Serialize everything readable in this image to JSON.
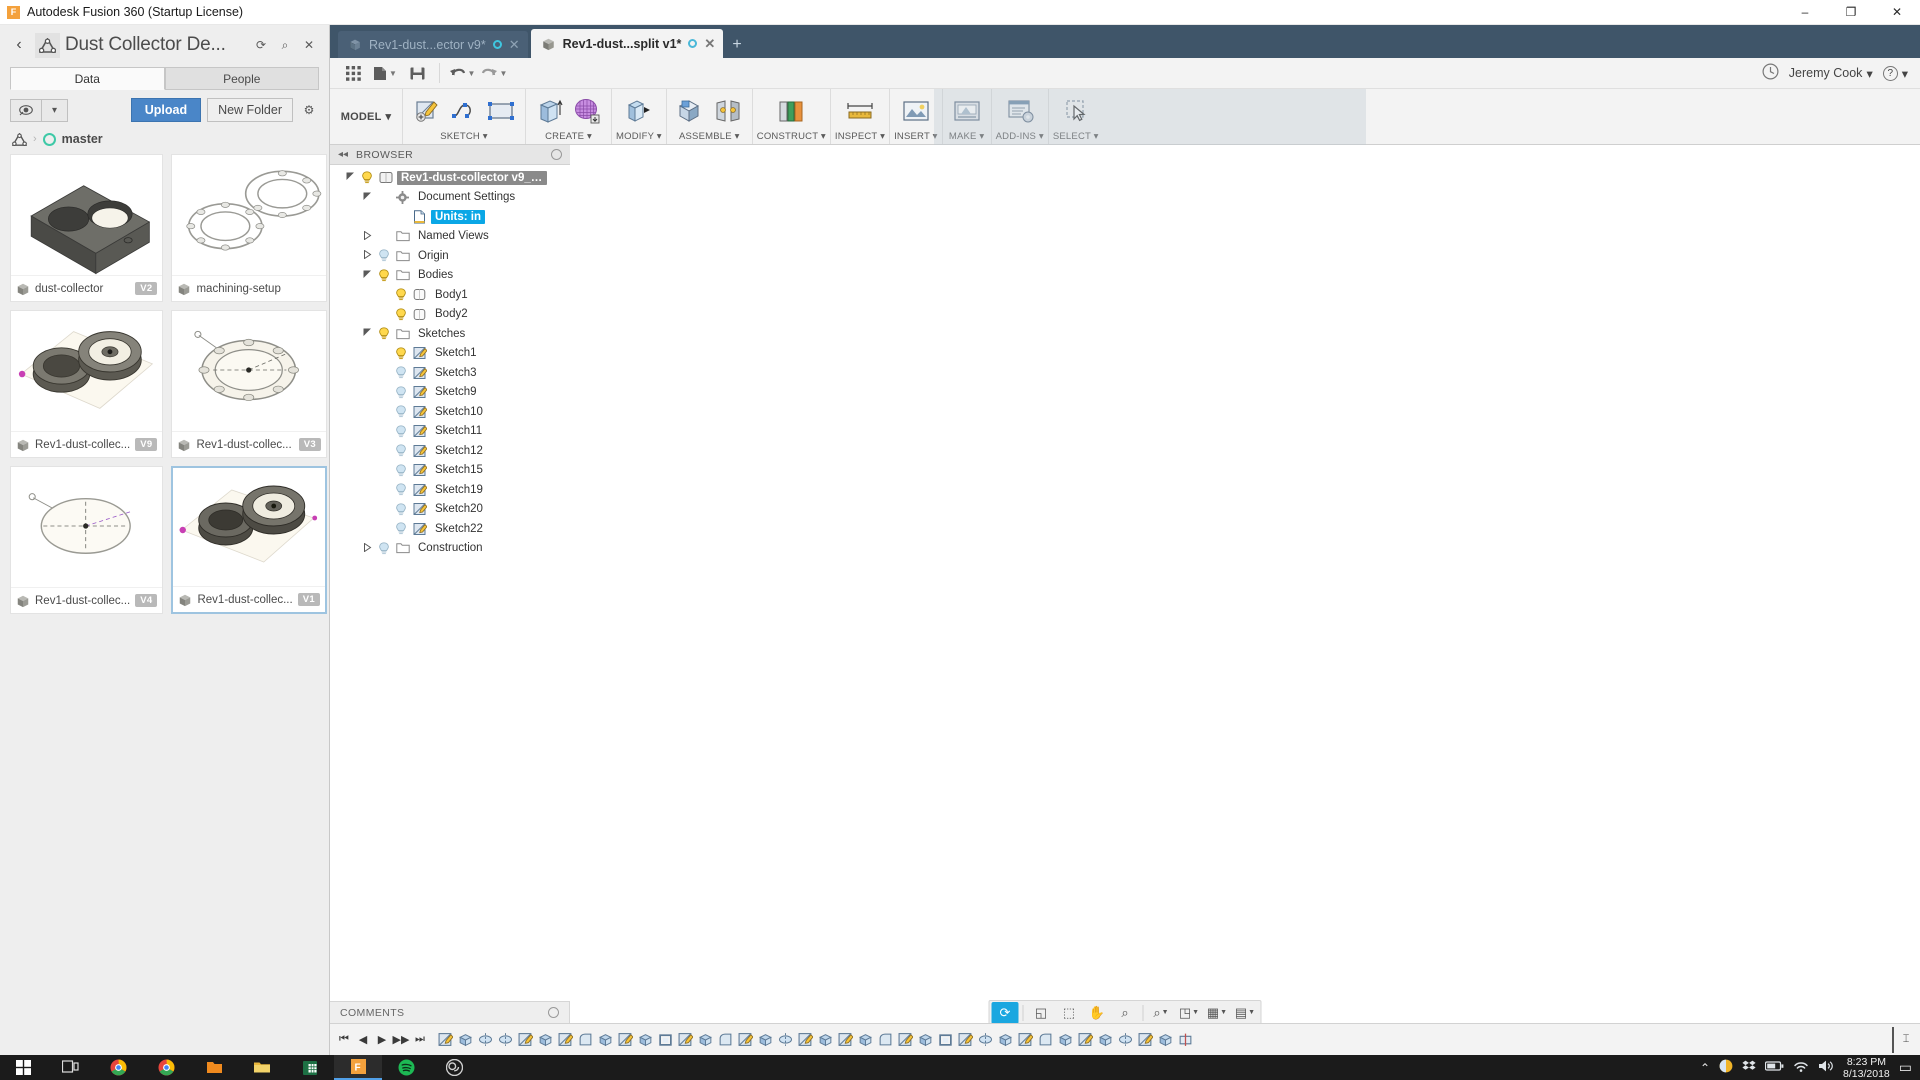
{
  "window": {
    "title": "Autodesk Fusion 360 (Startup License)",
    "app_icon": "F",
    "minimize": "–",
    "maximize": "❐",
    "close": "✕"
  },
  "data_panel": {
    "back_icon": "‹",
    "logo_icon": "fusion-logo-icon",
    "project_title": "Dust Collector De...",
    "refresh_icon": "⟳",
    "search_icon": "⌕",
    "close_icon": "✕",
    "tabs": [
      {
        "label": "Data",
        "active": true
      },
      {
        "label": "People",
        "active": false
      }
    ],
    "eye_icon": "◉",
    "caret_icon": "▾",
    "upload_label": "Upload",
    "new_folder_label": "New Folder",
    "gear_icon": "⚙",
    "breadcrumb": {
      "hub_icon": "hub-icon",
      "separator": "›",
      "project": "master"
    },
    "files": [
      {
        "name": "dust-collector",
        "version": "V2",
        "thumb": "block-two-bores",
        "selected": false
      },
      {
        "name": "machining-setup",
        "version": "",
        "thumb": "two-rings",
        "selected": false
      },
      {
        "name": "Rev1-dust-collec...",
        "version": "V9",
        "thumb": "assembly-dual",
        "selected": false
      },
      {
        "name": "Rev1-dust-collec...",
        "version": "V3",
        "thumb": "ring-flat",
        "selected": false
      },
      {
        "name": "Rev1-dust-collec...",
        "version": "V4",
        "thumb": "ring-sketch",
        "selected": false
      },
      {
        "name": "Rev1-dust-collec...",
        "version": "V1",
        "thumb": "assembly-dark",
        "selected": true
      }
    ]
  },
  "tabstrip": {
    "tabs": [
      {
        "label": "Rev1-dust...ector v9*",
        "active": false,
        "has_dot": true,
        "close": "✕"
      },
      {
        "label": "Rev1-dust...split v1*",
        "active": true,
        "has_dot": true,
        "close": "✕"
      }
    ],
    "new_tab": "+"
  },
  "quick_bar": {
    "buttons": [
      {
        "name": "grid-apps-icon",
        "caret": false
      },
      {
        "name": "file-icon",
        "caret": true
      },
      {
        "name": "save-icon",
        "caret": false
      },
      {
        "name": "undo-icon",
        "caret": true
      },
      {
        "name": "redo-icon",
        "caret": true
      }
    ],
    "help_icon": "ⓘ",
    "user_name": "Jeremy Cook",
    "user_caret": "▾",
    "question_icon": "?",
    "question_caret": "▾"
  },
  "ribbon": {
    "workspace": "MODEL",
    "workspace_caret": "▾",
    "groups": [
      {
        "label": "SKETCH ▾",
        "icons": [
          "create-sketch-icon",
          "spline-icon",
          "rectangle-icon"
        ]
      },
      {
        "label": "CREATE ▾",
        "icons": [
          "extrude-icon",
          "form-icon"
        ]
      },
      {
        "label": "MODIFY ▾",
        "icons": [
          "press-pull-icon"
        ]
      },
      {
        "label": "ASSEMBLE ▾",
        "icons": [
          "new-component-icon",
          "joint-icon"
        ]
      },
      {
        "label": "CONSTRUCT ▾",
        "icons": [
          "offset-plane-icon"
        ]
      },
      {
        "label": "INSPECT ▾",
        "icons": [
          "measure-icon"
        ]
      },
      {
        "label": "INSERT ▾",
        "icons": [
          "insert-decal-icon"
        ]
      },
      {
        "label": "MAKE ▾",
        "icons": [
          "3d-print-icon"
        ]
      },
      {
        "label": "ADD-INS ▾",
        "icons": [
          "scripts-addins-icon"
        ]
      },
      {
        "label": "SELECT ▾",
        "icons": [
          "select-icon"
        ]
      }
    ]
  },
  "browser": {
    "header": "BROWSER",
    "collapse_icon": "◂◂",
    "tree": [
      {
        "label": "Rev1-dust-collector v9_Rev1-...",
        "depth": 0,
        "arrow": "down",
        "bulb": "on",
        "icon": "component-icon",
        "style": "root"
      },
      {
        "label": "Document Settings",
        "depth": 1,
        "arrow": "down",
        "bulb": "none",
        "icon": "gear-icon",
        "style": "normal"
      },
      {
        "label": "Units: in",
        "depth": 2,
        "arrow": "none",
        "bulb": "none",
        "icon": "document-icon",
        "style": "selected"
      },
      {
        "label": "Named Views",
        "depth": 1,
        "arrow": "right",
        "bulb": "none",
        "icon": "folder-icon",
        "style": "normal"
      },
      {
        "label": "Origin",
        "depth": 1,
        "arrow": "right",
        "bulb": "off",
        "icon": "folder-icon",
        "style": "normal"
      },
      {
        "label": "Bodies",
        "depth": 1,
        "arrow": "down",
        "bulb": "on",
        "icon": "folder-icon",
        "style": "normal"
      },
      {
        "label": "Body1",
        "depth": 2,
        "arrow": "none",
        "bulb": "on",
        "icon": "body-icon",
        "style": "normal"
      },
      {
        "label": "Body2",
        "depth": 2,
        "arrow": "none",
        "bulb": "on",
        "icon": "body-icon",
        "style": "normal"
      },
      {
        "label": "Sketches",
        "depth": 1,
        "arrow": "down",
        "bulb": "on",
        "icon": "folder-icon",
        "style": "normal"
      },
      {
        "label": "Sketch1",
        "depth": 2,
        "arrow": "none",
        "bulb": "on",
        "icon": "sketch-icon",
        "style": "normal"
      },
      {
        "label": "Sketch3",
        "depth": 2,
        "arrow": "none",
        "bulb": "off",
        "icon": "sketch-icon",
        "style": "normal"
      },
      {
        "label": "Sketch9",
        "depth": 2,
        "arrow": "none",
        "bulb": "off",
        "icon": "sketch-icon",
        "style": "normal"
      },
      {
        "label": "Sketch10",
        "depth": 2,
        "arrow": "none",
        "bulb": "off",
        "icon": "sketch-icon",
        "style": "normal"
      },
      {
        "label": "Sketch11",
        "depth": 2,
        "arrow": "none",
        "bulb": "off",
        "icon": "sketch-icon",
        "style": "normal"
      },
      {
        "label": "Sketch12",
        "depth": 2,
        "arrow": "none",
        "bulb": "off",
        "icon": "sketch-icon",
        "style": "normal"
      },
      {
        "label": "Sketch15",
        "depth": 2,
        "arrow": "none",
        "bulb": "off",
        "icon": "sketch-icon",
        "style": "normal"
      },
      {
        "label": "Sketch19",
        "depth": 2,
        "arrow": "none",
        "bulb": "off",
        "icon": "sketch-icon",
        "style": "normal"
      },
      {
        "label": "Sketch20",
        "depth": 2,
        "arrow": "none",
        "bulb": "off",
        "icon": "sketch-icon",
        "style": "normal"
      },
      {
        "label": "Sketch22",
        "depth": 2,
        "arrow": "none",
        "bulb": "off",
        "icon": "sketch-icon",
        "style": "normal"
      },
      {
        "label": "Construction",
        "depth": 1,
        "arrow": "right",
        "bulb": "off",
        "icon": "folder-icon",
        "style": "normal"
      }
    ]
  },
  "comments": {
    "label": "COMMENTS"
  },
  "nav_bar": {
    "buttons": [
      {
        "name": "orbit-icon",
        "glyph": "⟳",
        "active": true,
        "caret": false
      },
      {
        "name": "look-at-icon",
        "glyph": "◱",
        "active": false,
        "caret": false
      },
      {
        "name": "fit-icon",
        "glyph": "⬚",
        "active": false,
        "caret": false
      },
      {
        "name": "pan-icon",
        "glyph": "✋",
        "active": false,
        "caret": false
      },
      {
        "name": "zoom-icon",
        "glyph": "⌕",
        "active": false,
        "caret": false
      },
      {
        "name": "zoom-window-icon",
        "glyph": "⌕",
        "active": false,
        "caret": true
      },
      {
        "name": "display-settings-icon",
        "glyph": "◳",
        "active": false,
        "caret": true
      },
      {
        "name": "grid-snaps-icon",
        "glyph": "▦",
        "active": false,
        "caret": true
      },
      {
        "name": "viewports-icon",
        "glyph": "▤",
        "active": false,
        "caret": true
      }
    ]
  },
  "timeline": {
    "play_buttons": [
      "⏮",
      "◀",
      "▶",
      "▶▶",
      "⏭"
    ],
    "feature_count": 38,
    "end_marker": "⌶"
  },
  "taskbar": {
    "start_icon": "windows-icon",
    "task_view_icon": "task-view-icon",
    "items": [
      {
        "name": "chrome-icon",
        "active": false
      },
      {
        "name": "chrome-icon-2",
        "active": false
      },
      {
        "name": "folder-orange-icon",
        "active": false
      },
      {
        "name": "file-explorer-icon",
        "active": false
      },
      {
        "name": "excel-icon",
        "active": false
      },
      {
        "name": "fusion360-icon",
        "active": true
      },
      {
        "name": "spotify-icon",
        "active": false
      },
      {
        "name": "obs-icon",
        "active": false
      }
    ],
    "tray": {
      "chevron": "⌃",
      "icons": [
        "sun-icon",
        "dropbox-icon",
        "battery-icon",
        "wifi-icon",
        "volume-icon"
      ],
      "time": "8:23 PM",
      "date": "8/13/2018",
      "action_center": "▭"
    }
  },
  "colors": {
    "accent_blue": "#4a86c8",
    "selection_cyan": "#0aa7e6",
    "tabstrip_bg": "#3f5569",
    "canvas_bg": "#fdfbf5",
    "nav_active": "#1aa7e0"
  }
}
